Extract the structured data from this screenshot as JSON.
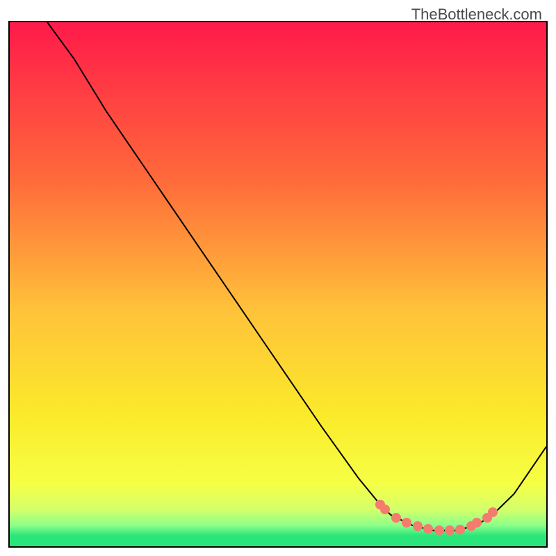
{
  "watermark": "TheBottleneck.com",
  "chart_data": {
    "type": "line",
    "title": "",
    "xlabel": "",
    "ylabel": "",
    "xlim": [
      0,
      100
    ],
    "ylim": [
      0,
      100
    ],
    "series": [
      {
        "name": "curve",
        "x": [
          7,
          12,
          18,
          26,
          34,
          42,
          50,
          58,
          65,
          69,
          71,
          73,
          75,
          77,
          79,
          81,
          83,
          85,
          87,
          90,
          94,
          100
        ],
        "y": [
          100,
          93,
          83,
          71,
          59,
          47,
          35,
          23,
          13,
          8,
          6,
          5,
          4,
          3.5,
          3,
          3,
          3,
          3.5,
          4,
          6,
          10,
          19
        ]
      }
    ],
    "dots": {
      "name": "markers",
      "x": [
        69,
        70,
        72,
        74,
        76,
        78,
        80,
        82,
        84,
        86,
        87,
        89,
        90
      ],
      "y": [
        8,
        7,
        5.5,
        4.5,
        3.8,
        3.3,
        3,
        3,
        3.2,
        3.8,
        4.5,
        5.5,
        6.5
      ]
    },
    "gradient_stops": [
      {
        "offset": 0,
        "color": "#ff1a4a"
      },
      {
        "offset": 30,
        "color": "#ff6a3a"
      },
      {
        "offset": 55,
        "color": "#ffc23a"
      },
      {
        "offset": 75,
        "color": "#fbea2a"
      },
      {
        "offset": 88,
        "color": "#f6ff45"
      },
      {
        "offset": 93,
        "color": "#d4ff6a"
      },
      {
        "offset": 96,
        "color": "#8cff8a"
      },
      {
        "offset": 98,
        "color": "#2ae57a"
      },
      {
        "offset": 100,
        "color": "#2ae57a"
      }
    ]
  }
}
